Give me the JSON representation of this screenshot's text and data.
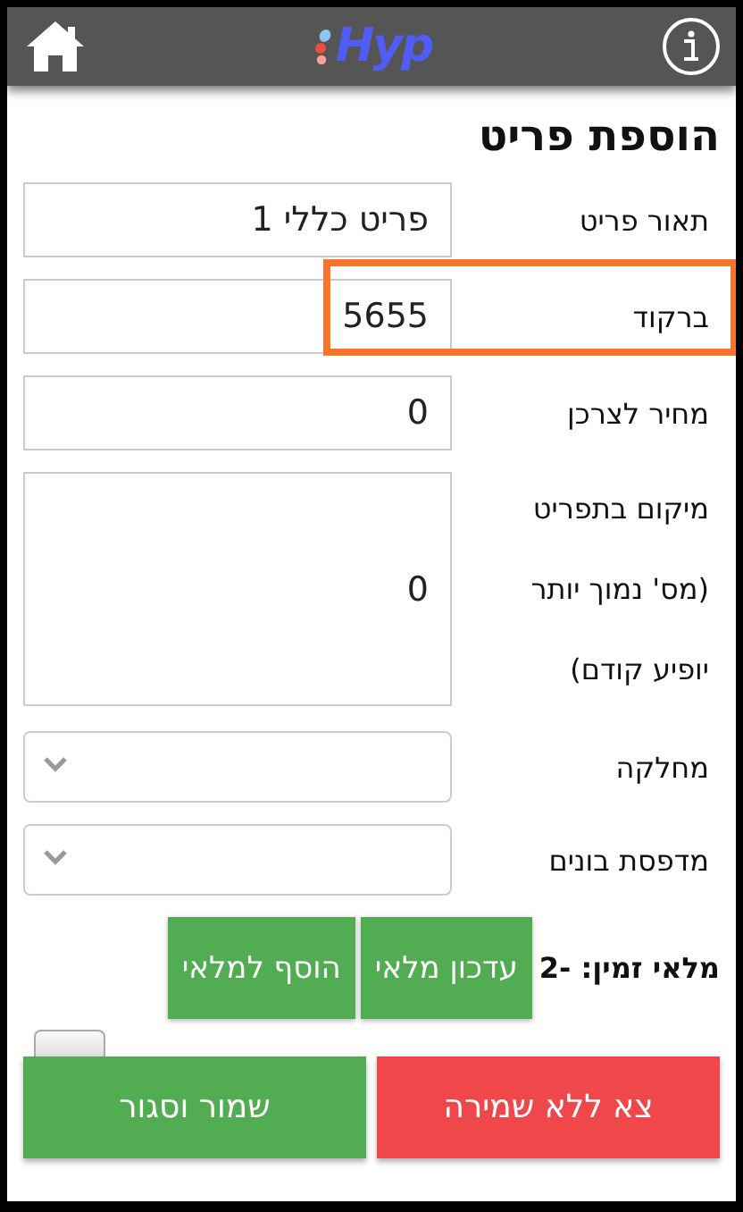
{
  "header": {
    "logo": "Hyp"
  },
  "title": "הוספת פריט",
  "fields": [
    {
      "kind": "text",
      "label": [
        "תאור פריט"
      ],
      "value": "פריט כללי 1",
      "highlighted": false
    },
    {
      "kind": "text",
      "label": [
        "ברקוד"
      ],
      "value": "5655",
      "highlighted": true
    },
    {
      "kind": "text",
      "label": [
        "מחיר לצרכן"
      ],
      "value": "0",
      "highlighted": false
    },
    {
      "kind": "textarea",
      "label": [
        "מיקום בתפריט",
        "(מס' נמוך יותר",
        "יופיע קודם)"
      ],
      "value": "0",
      "highlighted": false
    },
    {
      "kind": "select",
      "label": [
        "מחלקה"
      ],
      "highlighted": false
    },
    {
      "kind": "select",
      "label": [
        "מדפסת בונים"
      ],
      "highlighted": false
    }
  ],
  "stock": {
    "label": "מלאי זמין: -2",
    "buttons": [
      "עדכון מלאי",
      "הוסף למלאי"
    ]
  },
  "toggle": {
    "on": false
  },
  "footer": [
    {
      "kind": "danger",
      "label": "צא ללא שמירה"
    },
    {
      "kind": "primary",
      "label": "שמור וסגור"
    }
  ]
}
